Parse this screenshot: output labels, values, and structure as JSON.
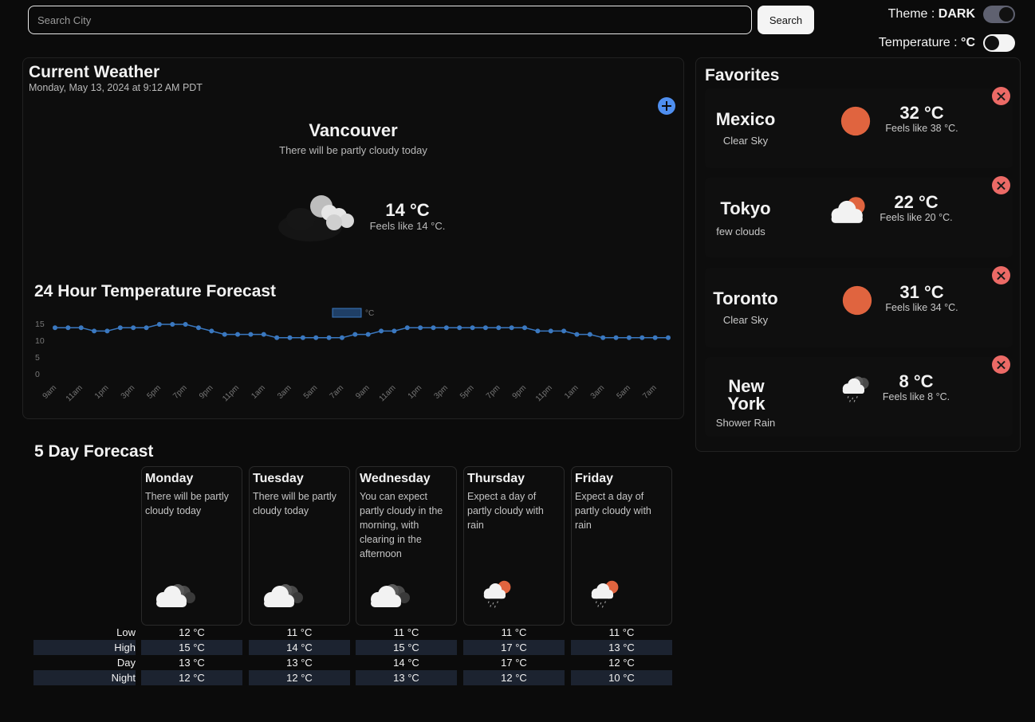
{
  "search": {
    "placeholder": "Search City",
    "value": "",
    "button_label": "Search"
  },
  "settings": {
    "theme_label": "Theme :",
    "theme_value": "DARK",
    "temp_label": "Temperature :",
    "temp_value": "°C"
  },
  "current": {
    "heading": "Current Weather",
    "datetime": "Monday, May 13, 2024 at 9:12 AM PDT",
    "city": "Vancouver",
    "description": "There will be partly cloudy today",
    "temp": "14 °C",
    "feels": "Feels like 14 °C.",
    "icon": "partly-cloudy-night-icon",
    "add_icon": "plus-circle-icon"
  },
  "hourly": {
    "heading": "24 Hour Temperature Forecast",
    "chart_data": {
      "type": "line",
      "legend": "°C",
      "x": [
        "9am",
        "10am",
        "11am",
        "12pm",
        "1pm",
        "2pm",
        "3pm",
        "4pm",
        "5pm",
        "6pm",
        "7pm",
        "8pm",
        "9pm",
        "10pm",
        "11pm",
        "12am",
        "1am",
        "2am",
        "3am",
        "4am",
        "5am",
        "6am",
        "7am",
        "8am",
        "9am",
        "10am",
        "11am",
        "12pm",
        "1pm",
        "2pm",
        "3pm",
        "4pm",
        "5pm",
        "6pm",
        "7pm",
        "8pm",
        "9pm",
        "10pm",
        "11pm",
        "12am",
        "1am",
        "2am",
        "3am",
        "4am",
        "5am",
        "6am",
        "7am",
        "8am"
      ],
      "tick_labels": [
        "9am",
        "11am",
        "1pm",
        "3pm",
        "5pm",
        "7pm",
        "9pm",
        "11pm",
        "1am",
        "3am",
        "5am",
        "7am",
        "9am",
        "11am",
        "1pm",
        "3pm",
        "5pm",
        "7pm",
        "9pm",
        "11pm",
        "1am",
        "3am",
        "5am",
        "7am"
      ],
      "y": [
        14,
        14,
        14,
        13,
        13,
        14,
        14,
        14,
        15,
        15,
        15,
        14,
        13,
        12,
        12,
        12,
        12,
        11,
        11,
        11,
        11,
        11,
        11,
        12,
        12,
        13,
        13,
        14,
        14,
        14,
        14,
        14,
        14,
        14,
        14,
        14,
        14,
        13,
        13,
        13,
        12,
        12,
        11,
        11,
        11,
        11,
        11,
        11
      ],
      "y_ticks": [
        0,
        5,
        10,
        15
      ],
      "ylim": [
        0,
        15
      ],
      "color": "#3a78c0"
    }
  },
  "forecast": {
    "heading": "5 Day Forecast",
    "row_labels": [
      "Low",
      "High",
      "Day",
      "Night"
    ],
    "days": [
      {
        "name": "Monday",
        "desc": "There will be partly cloudy today",
        "icon": "cloud-icon",
        "low": "12 °C",
        "high": "15 °C",
        "day": "13 °C",
        "night": "12 °C"
      },
      {
        "name": "Tuesday",
        "desc": "There will be partly cloudy today",
        "icon": "cloud-icon",
        "low": "11 °C",
        "high": "14 °C",
        "day": "13 °C",
        "night": "12 °C"
      },
      {
        "name": "Wednesday",
        "desc": "You can expect partly cloudy in the morning, with clearing in the afternoon",
        "icon": "cloud-icon",
        "low": "11 °C",
        "high": "15 °C",
        "day": "14 °C",
        "night": "13 °C"
      },
      {
        "name": "Thursday",
        "desc": "Expect a day of partly cloudy with rain",
        "icon": "sun-rain-icon",
        "low": "11 °C",
        "high": "17 °C",
        "day": "17 °C",
        "night": "12 °C"
      },
      {
        "name": "Friday",
        "desc": "Expect a day of partly cloudy with rain",
        "icon": "sun-rain-icon",
        "low": "11 °C",
        "high": "13 °C",
        "day": "12 °C",
        "night": "10 °C"
      }
    ]
  },
  "favorites": {
    "heading": "Favorites",
    "items": [
      {
        "city": "Mexico",
        "cond": "Clear Sky",
        "temp": "32 °C",
        "feels": "Feels like 38 °C.",
        "icon": "sun-icon"
      },
      {
        "city": "Tokyo",
        "cond": "few clouds",
        "temp": "22 °C",
        "feels": "Feels like 20 °C.",
        "icon": "sun-cloud-icon"
      },
      {
        "city": "Toronto",
        "cond": "Clear Sky",
        "temp": "31 °C",
        "feels": "Feels like 34 °C.",
        "icon": "sun-icon"
      },
      {
        "city": "New York",
        "cond": "Shower Rain",
        "temp": "8 °C",
        "feels": "Feels like 8 °C.",
        "icon": "rain-cloud-icon"
      }
    ]
  },
  "colors": {
    "accent": "#3a78c0",
    "sun": "#e0643f",
    "remove": "#ec6a66",
    "add": "#4f8ff0"
  }
}
